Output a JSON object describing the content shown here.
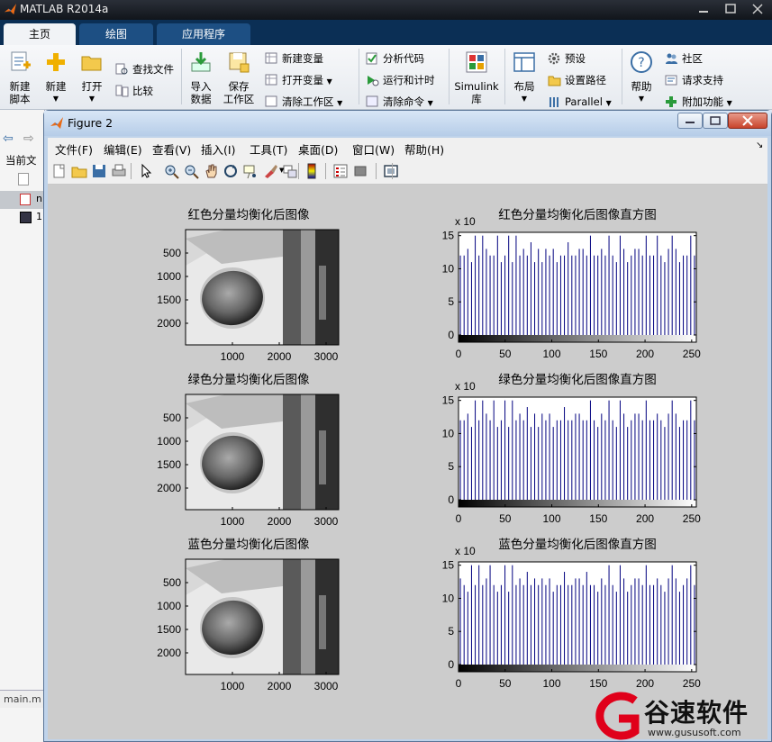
{
  "app": {
    "title": "MATLAB R2014a"
  },
  "ribbon_tabs": [
    {
      "label": "主页",
      "active": true
    },
    {
      "label": "绘图",
      "active": false
    },
    {
      "label": "应用程序",
      "active": false
    }
  ],
  "ribbon": {
    "new_script": [
      "新建",
      "脚本"
    ],
    "new": "新建",
    "open": "打开",
    "find_files": "查找文件",
    "compare": "比较",
    "import_data": [
      "导入",
      "数据"
    ],
    "save_workspace": [
      "保存",
      "工作区"
    ],
    "new_variable": "新建变量",
    "open_variable": "打开变量",
    "clear_workspace": "清除工作区",
    "analyze_code": "分析代码",
    "run_and_time": "运行和计时",
    "clear_commands": "清除命令",
    "simulink": [
      "Simulink",
      "库"
    ],
    "layout": "布局",
    "preferences": "预设",
    "set_path": "设置路径",
    "parallel": "Parallel",
    "help": "帮助",
    "community": "社区",
    "request_support": "请求支持",
    "addons": "附加功能"
  },
  "left_panel": {
    "current_folder": "当前文",
    "file1": "n",
    "file2": "1",
    "bottom_file": "main.m"
  },
  "figure": {
    "title": "Figure 2",
    "menus": [
      "文件(F)",
      "编辑(E)",
      "查看(V)",
      "插入(I)",
      "工具(T)",
      "桌面(D)",
      "窗口(W)",
      "帮助(H)"
    ],
    "toolbar_icons": [
      "new-figure-icon",
      "open-file-icon",
      "save-icon",
      "print-icon",
      "pointer-icon",
      "zoom-in-icon",
      "zoom-out-icon",
      "pan-icon",
      "rotate-icon",
      "data-cursor-icon",
      "brush-icon",
      "link-icon",
      "colorbar-icon",
      "legend-icon",
      "hide-plot-tools-icon",
      "show-plot-tools-icon"
    ]
  },
  "image_panels": [
    {
      "title": "红色分量均衡化后图像",
      "y_ticks": [
        "500",
        "1000",
        "1500",
        "2000"
      ],
      "x_ticks": [
        "1000",
        "2000",
        "3000"
      ]
    },
    {
      "title": "绿色分量均衡化后图像",
      "y_ticks": [
        "500",
        "1000",
        "1500",
        "2000"
      ],
      "x_ticks": [
        "1000",
        "2000",
        "3000"
      ]
    },
    {
      "title": "蓝色分量均衡化后图像",
      "y_ticks": [
        "500",
        "1000",
        "1500",
        "2000"
      ],
      "x_ticks": [
        "1000",
        "2000",
        "3000"
      ]
    }
  ],
  "chart_data": [
    {
      "type": "bar",
      "title": "红色分量均衡化后图像直方图",
      "exponent_label": "x 10",
      "xlim": [
        0,
        255
      ],
      "ylim": [
        0,
        15.5
      ],
      "x_ticks": [
        0,
        50,
        100,
        150,
        200,
        250
      ],
      "y_ticks": [
        0,
        5,
        10,
        15
      ],
      "values": [
        12,
        12,
        13,
        11,
        15,
        12,
        15,
        13,
        12,
        12,
        15,
        11,
        12,
        15,
        11,
        15,
        12,
        13,
        12,
        14,
        11,
        13,
        11,
        13,
        12,
        13,
        11,
        12,
        12,
        14,
        12,
        12,
        13,
        13,
        12,
        15,
        12,
        12,
        13,
        12,
        15,
        12,
        11,
        15,
        13,
        11,
        12,
        13,
        13,
        12,
        15,
        12,
        12,
        15,
        12,
        11,
        13,
        15,
        13,
        11,
        12,
        12,
        15,
        12
      ]
    },
    {
      "type": "bar",
      "title": "绿色分量均衡化后图像直方图",
      "exponent_label": "x 10",
      "xlim": [
        0,
        255
      ],
      "ylim": [
        0,
        15.5
      ],
      "x_ticks": [
        0,
        50,
        100,
        150,
        200,
        250
      ],
      "y_ticks": [
        0,
        5,
        10,
        15
      ],
      "values": [
        12,
        12,
        13,
        11,
        15,
        12,
        15,
        13,
        12,
        15,
        11,
        12,
        15,
        11,
        15,
        12,
        13,
        12,
        14,
        11,
        13,
        11,
        13,
        12,
        13,
        11,
        12,
        12,
        14,
        12,
        12,
        13,
        13,
        12,
        12,
        15,
        12,
        11,
        13,
        12,
        15,
        12,
        11,
        15,
        13,
        11,
        12,
        13,
        13,
        12,
        15,
        12,
        12,
        13,
        12,
        11,
        13,
        15,
        13,
        11,
        12,
        12,
        15,
        12
      ]
    },
    {
      "type": "bar",
      "title": "蓝色分量均衡化后图像直方图",
      "exponent_label": "x 10",
      "xlim": [
        0,
        255
      ],
      "ylim": [
        0,
        15.5
      ],
      "x_ticks": [
        0,
        50,
        100,
        150,
        200,
        250
      ],
      "y_ticks": [
        0,
        5,
        10,
        15
      ],
      "values": [
        13,
        12,
        11,
        15,
        12,
        15,
        12,
        13,
        15,
        12,
        11,
        12,
        15,
        11,
        15,
        12,
        13,
        12,
        14,
        12,
        13,
        12,
        13,
        12,
        13,
        11,
        12,
        12,
        14,
        12,
        12,
        13,
        13,
        12,
        14,
        12,
        12,
        11,
        13,
        12,
        15,
        12,
        11,
        15,
        13,
        11,
        12,
        13,
        13,
        12,
        15,
        12,
        12,
        13,
        12,
        11,
        13,
        15,
        13,
        11,
        12,
        13,
        15,
        12
      ]
    }
  ],
  "watermark": {
    "brand": "谷速软件",
    "url": "www.gususoft.com"
  },
  "colors": {
    "bar": "#00007f",
    "tab_active": "#f1f3f6",
    "tab_bar": "#0b2f55",
    "canvas": "#cccccc"
  }
}
